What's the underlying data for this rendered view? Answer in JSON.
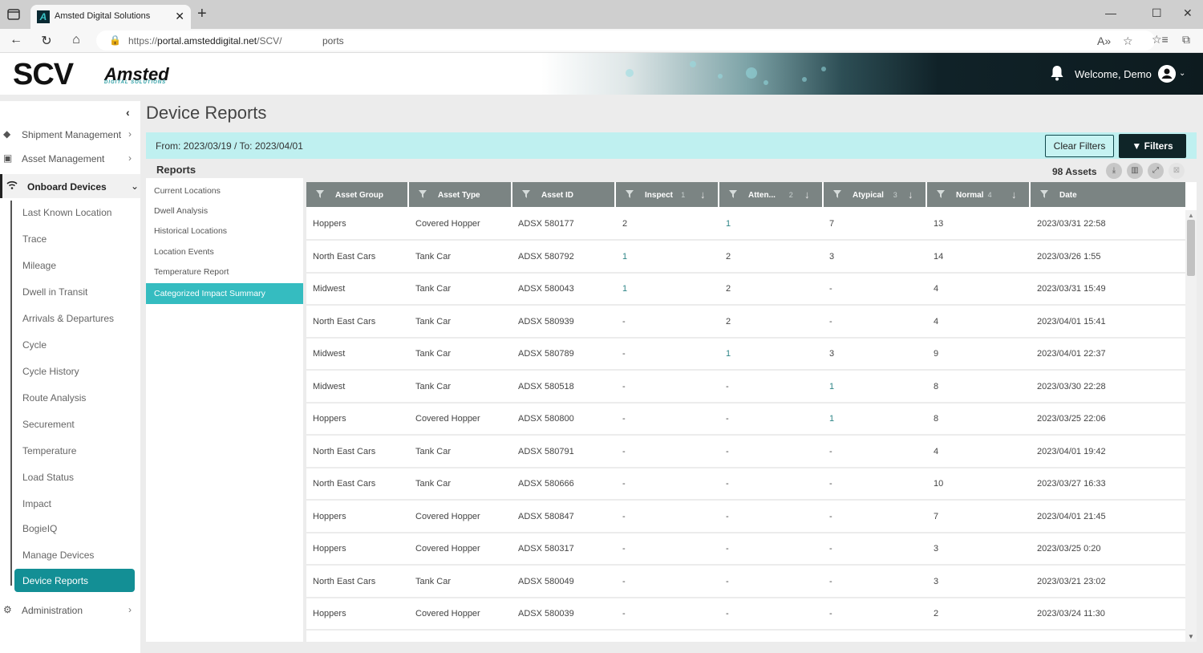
{
  "browser": {
    "tab_title": "Amsted Digital Solutions",
    "url_prefix": "https://",
    "url_host": "portal.amsteddigital.net",
    "url_path": "/SCV/",
    "url_tail": "ports"
  },
  "header": {
    "logo_main": "SCV",
    "logo_brand": "Amsted",
    "logo_sub": "DIGITAL SOLUTIONS",
    "welcome": "Welcome, Demo"
  },
  "sidebar": {
    "top_items": [
      {
        "label": "Shipment Management",
        "icon": "tag-icon"
      },
      {
        "label": "Asset Management",
        "icon": "train-icon"
      },
      {
        "label": "Onboard Devices",
        "icon": "wifi-icon"
      }
    ],
    "sub_items": [
      "Last Known Location",
      "Trace",
      "Mileage",
      "Dwell in Transit",
      "Arrivals & Departures",
      "Cycle",
      "Cycle History",
      "Route Analysis",
      "Securement",
      "Temperature",
      "Load Status",
      "Impact",
      "BogieIQ",
      "Manage Devices"
    ],
    "active_sub": "Device Reports",
    "bottom_item": {
      "label": "Administration",
      "icon": "gear-icon"
    }
  },
  "main": {
    "title": "Device Reports",
    "date_range": "From: 2023/03/19  /  To: 2023/04/01",
    "clear_filters": "Clear Filters",
    "filters": "Filters",
    "reports_heading": "Reports",
    "reports": [
      "Current Locations",
      "Dwell Analysis",
      "Historical Locations",
      "Location Events",
      "Temperature Report"
    ],
    "active_report": "Categorized Impact Summary",
    "assets_count": "98 Assets"
  },
  "table": {
    "columns": [
      {
        "label": "Asset Group",
        "num": "",
        "sort": false
      },
      {
        "label": "Asset Type",
        "num": "",
        "sort": false
      },
      {
        "label": "Asset ID",
        "num": "",
        "sort": false
      },
      {
        "label": "Inspect",
        "num": "1",
        "sort": true
      },
      {
        "label": "Atten...",
        "num": "2",
        "sort": true
      },
      {
        "label": "Atypical",
        "num": "3",
        "sort": true
      },
      {
        "label": "Normal",
        "num": "4",
        "sort": true
      },
      {
        "label": "Date",
        "num": "",
        "sort": false
      }
    ],
    "rows": [
      [
        "Hoppers",
        "Covered Hopper",
        "ADSX 580177",
        "2",
        "1",
        "7",
        "13",
        "2023/03/31 22:58"
      ],
      [
        "North East Cars",
        "Tank Car",
        "ADSX 580792",
        "1",
        "2",
        "3",
        "14",
        "2023/03/26 1:55"
      ],
      [
        "Midwest",
        "Tank Car",
        "ADSX 580043",
        "1",
        "2",
        "-",
        "4",
        "2023/03/31 15:49"
      ],
      [
        "North East Cars",
        "Tank Car",
        "ADSX 580939",
        "-",
        "2",
        "-",
        "4",
        "2023/04/01 15:41"
      ],
      [
        "Midwest",
        "Tank Car",
        "ADSX 580789",
        "-",
        "1",
        "3",
        "9",
        "2023/04/01 22:37"
      ],
      [
        "Midwest",
        "Tank Car",
        "ADSX 580518",
        "-",
        "-",
        "1",
        "8",
        "2023/03/30 22:28"
      ],
      [
        "Hoppers",
        "Covered Hopper",
        "ADSX 580800",
        "-",
        "-",
        "1",
        "8",
        "2023/03/25 22:06"
      ],
      [
        "North East Cars",
        "Tank Car",
        "ADSX 580791",
        "-",
        "-",
        "-",
        "4",
        "2023/04/01 19:42"
      ],
      [
        "North East Cars",
        "Tank Car",
        "ADSX 580666",
        "-",
        "-",
        "-",
        "10",
        "2023/03/27 16:33"
      ],
      [
        "Hoppers",
        "Covered Hopper",
        "ADSX 580847",
        "-",
        "-",
        "-",
        "7",
        "2023/04/01 21:45"
      ],
      [
        "Hoppers",
        "Covered Hopper",
        "ADSX 580317",
        "-",
        "-",
        "-",
        "3",
        "2023/03/25 0:20"
      ],
      [
        "North East Cars",
        "Tank Car",
        "ADSX 580049",
        "-",
        "-",
        "-",
        "3",
        "2023/03/21 23:02"
      ],
      [
        "Hoppers",
        "Covered Hopper",
        "ADSX 580039",
        "-",
        "-",
        "-",
        "2",
        "2023/03/24 11:30"
      ]
    ]
  },
  "colors": {
    "accent_teal": "#138f95",
    "active_report": "#35bcc0",
    "banner": "#bff0f0",
    "table_header": "#7b8483",
    "highlight_value": "#2e8587"
  }
}
